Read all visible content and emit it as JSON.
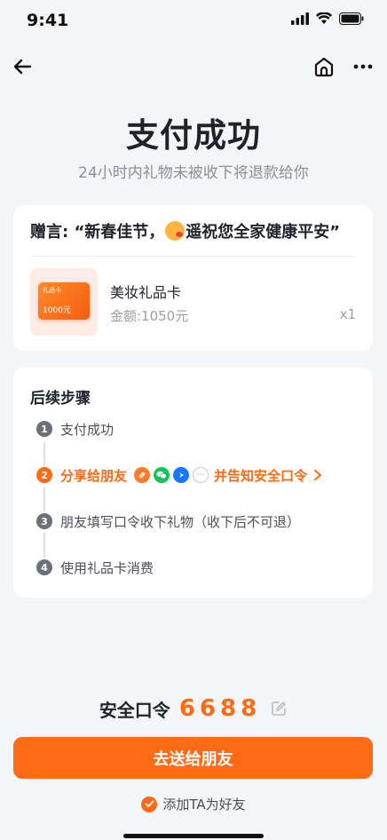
{
  "status_bar": {
    "time": "9:41",
    "icons": [
      "signal-icon",
      "wifi-icon",
      "battery-icon"
    ]
  },
  "nav": {
    "icons": [
      "back-arrow-icon",
      "home-icon",
      "more-icon"
    ]
  },
  "header": {
    "title": "支付成功",
    "subtitle": "24小时内礼物未被收下将退款给你"
  },
  "gift": {
    "message_prefix": "赠言: “新春佳节，",
    "message_emoji": "kiss-emoji-icon",
    "message_suffix": "遥祝您全家健康平安”",
    "product": {
      "thumbnail_title": "礼品卡",
      "thumbnail_amount": "1000元",
      "name": "美妆礼品卡",
      "amount": "金额:1050元",
      "quantity": "x1"
    }
  },
  "steps": {
    "title": "后续步骤",
    "items": [
      {
        "num": "1",
        "label": "支付成功",
        "active": false
      },
      {
        "num": "2",
        "label": "分享给朋友",
        "active": true,
        "suffix": "并告知安全口令",
        "share_icons": [
          "link-icon",
          "wechat-icon",
          "tiktok-icon",
          "more-dots-icon"
        ]
      },
      {
        "num": "3",
        "label": "朋友填写口令收下礼物（收下后不可退）",
        "active": false
      },
      {
        "num": "4",
        "label": "使用礼品卡消费",
        "active": false
      }
    ]
  },
  "security": {
    "label": "安全口令",
    "code": "6688"
  },
  "cta": {
    "label": "去送给朋友"
  },
  "add_friend": {
    "label": "添加TA为好友",
    "checked": true
  },
  "colors": {
    "accent": "#ff6a14",
    "background": "#f4f5f7",
    "card": "#ffffff",
    "muted_text": "#8a8f99",
    "step_number_gray": "#6b7079"
  }
}
